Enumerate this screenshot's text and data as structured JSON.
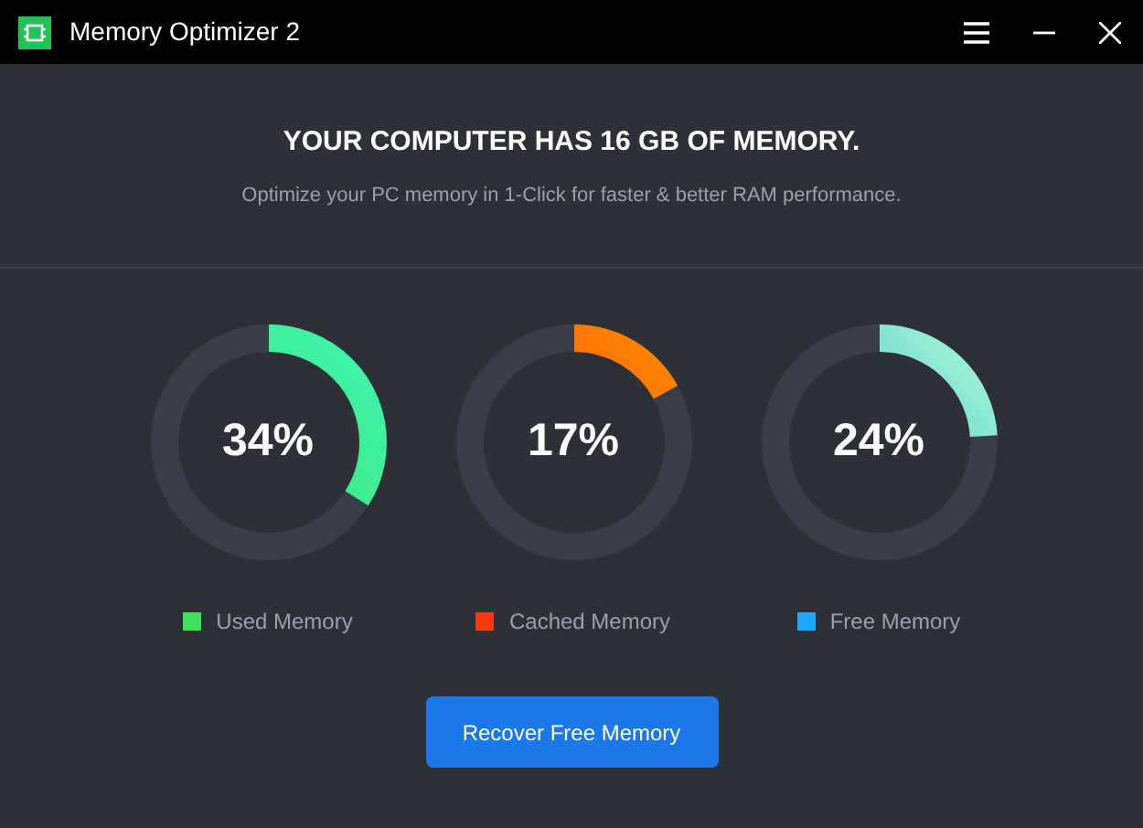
{
  "window": {
    "title": "Memory Optimizer 2"
  },
  "heading": "YOUR COMPUTER HAS 16 GB OF MEMORY.",
  "subtitle": "Optimize your PC memory in 1-Click for faster & better RAM performance.",
  "gauges": [
    {
      "reading": "34%",
      "level": 0.34,
      "label": "Used Memory",
      "color": "#3ee05c"
    },
    {
      "reading": "17%",
      "level": 0.17,
      "label": "Cached Memory",
      "color": "#f83a0c"
    },
    {
      "reading": "24%",
      "level": 0.24,
      "label": "Free Memory",
      "color": "#1ea7fd"
    }
  ],
  "button": "Recover Free Memory"
}
